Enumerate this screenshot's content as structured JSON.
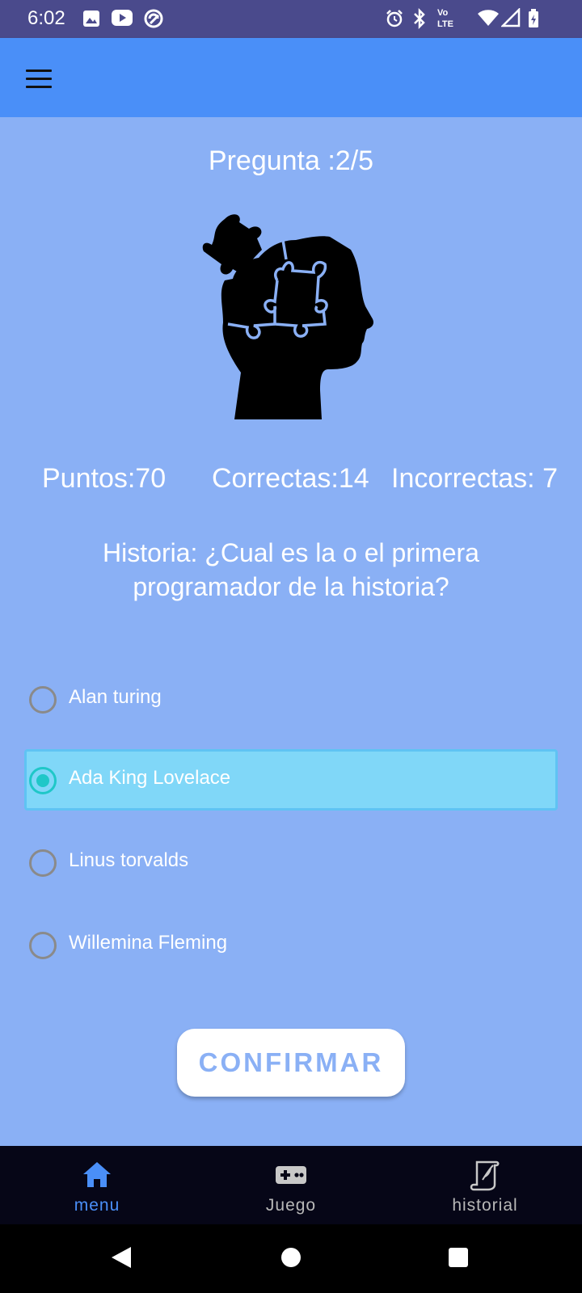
{
  "status_bar": {
    "time": "6:02",
    "network": "Vo LTE"
  },
  "quiz": {
    "progress_label": "Pregunta :2/5",
    "stats": {
      "points": "Puntos:70",
      "correct": "Correctas:14",
      "incorrect": "Incorrectas: 7"
    },
    "question": "Historia: ¿Cual es  la o el primera programador de la historia?",
    "options": [
      {
        "label": "Alan turing",
        "selected": false
      },
      {
        "label": "Ada King Lovelace",
        "selected": true
      },
      {
        "label": "Linus torvalds",
        "selected": false
      },
      {
        "label": "Willemina Fleming",
        "selected": false
      }
    ],
    "confirm_label": "CONFIRMAR"
  },
  "bottom_nav": {
    "items": [
      {
        "label": "menu",
        "icon": "home-icon",
        "active": true
      },
      {
        "label": "Juego",
        "icon": "gamepad-icon",
        "active": false
      },
      {
        "label": "historial",
        "icon": "scroll-icon",
        "active": false
      }
    ]
  },
  "colors": {
    "status_bar": "#4a4a8c",
    "app_bar": "#4a8ff8",
    "background": "#8ab0f5",
    "selected_option": "#80d7f8",
    "radio_selected": "#1fc7c8",
    "bottom_nav": "#060617",
    "nav_active": "#4a8ff8"
  }
}
